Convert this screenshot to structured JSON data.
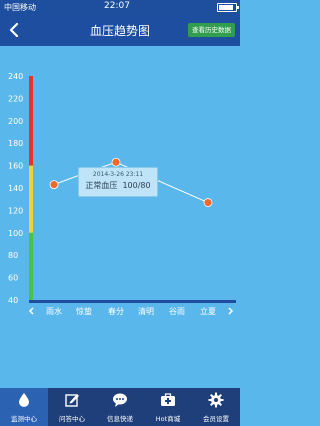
{
  "status_bar": {
    "carrier": "中国移动",
    "time": "22:07"
  },
  "header": {
    "title": "血压趋势图",
    "history_button": "查看历史数据"
  },
  "chart_data": {
    "type": "line",
    "y_ticks": [
      240,
      220,
      200,
      180,
      160,
      140,
      120,
      100,
      80,
      60,
      40
    ],
    "ylim": [
      40,
      240
    ],
    "categories": [
      "雨水",
      "惊蛰",
      "春分",
      "清明",
      "谷雨",
      "立夏"
    ],
    "points": [
      {
        "x": "雨水",
        "y": 143
      },
      {
        "x": "惊蛰",
        "y": 153
      },
      {
        "x": "春分",
        "y": 163
      },
      {
        "x": "立夏",
        "y": 127
      }
    ],
    "line_color": "#ffffff",
    "point_color": "#f0682a",
    "level_colors": [
      "#e8322c",
      "#f1d23a",
      "#4cc14a"
    ],
    "tooltip": {
      "date": "2014-3-26  23:11",
      "label": "正常血压",
      "value": "100/80"
    }
  },
  "tabbar": {
    "tabs": [
      {
        "label": "监测中心",
        "icon": "drop-icon",
        "active": true
      },
      {
        "label": "问答中心",
        "icon": "edit-icon",
        "active": false
      },
      {
        "label": "信息快递",
        "icon": "chat-icon",
        "active": false
      },
      {
        "label": "Hot商城",
        "icon": "medkit-icon",
        "active": false
      },
      {
        "label": "会员设置",
        "icon": "gear-icon",
        "active": false
      }
    ]
  }
}
